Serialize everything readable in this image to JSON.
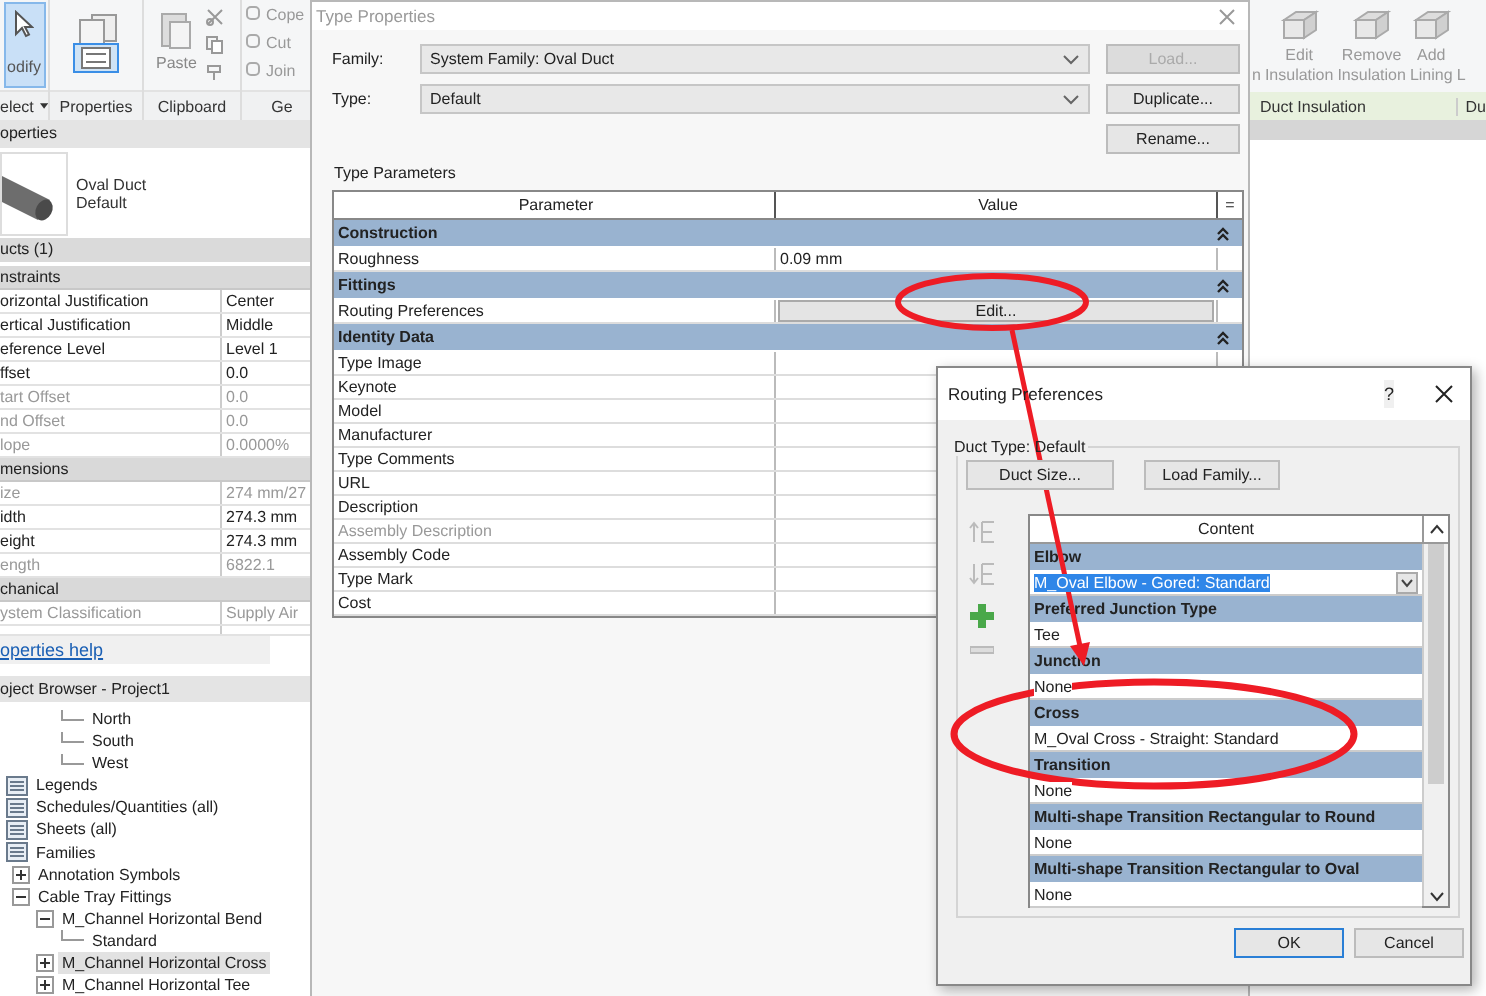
{
  "ribbon_left": {
    "modify": {
      "label": "odify",
      "selected": true
    },
    "panel_labels": [
      "elect",
      "Properties",
      "Clipboard",
      "Ge"
    ],
    "paste": "Paste",
    "geometry_tools": [
      "Cope",
      "Cut",
      "Join"
    ]
  },
  "ribbon_right": {
    "buttons": [
      {
        "lines": [
          "n"
        ]
      },
      {
        "lines": [
          "Edit",
          "Insulation"
        ]
      },
      {
        "lines": [
          "Remove",
          "Insulation"
        ]
      },
      {
        "lines": [
          "Add",
          "Lining"
        ]
      },
      {
        "lines": [
          "L"
        ]
      }
    ],
    "panel_labels": [
      "Duct Insulation",
      "Du"
    ]
  },
  "properties": {
    "title": "operties",
    "type_name": "Oval Duct",
    "type_sub": "Default",
    "instance": "ucts (1)",
    "groups": [
      {
        "name": "nstraints",
        "rows": [
          {
            "label": "orizontal Justification",
            "value": "Center",
            "disabled": false
          },
          {
            "label": "ertical Justification",
            "value": "Middle",
            "disabled": false
          },
          {
            "label": "eference Level",
            "value": "Level 1",
            "disabled": false
          },
          {
            "label": "ffset",
            "value": "0.0",
            "disabled": false
          },
          {
            "label": "tart Offset",
            "value": "0.0",
            "disabled": true
          },
          {
            "label": "nd Offset",
            "value": "0.0",
            "disabled": true
          },
          {
            "label": "lope",
            "value": "0.0000%",
            "disabled": true
          }
        ]
      },
      {
        "name": "mensions",
        "rows": [
          {
            "label": "ize",
            "value": "274 mm/27",
            "disabled": true
          },
          {
            "label": "idth",
            "value": "274.3 mm",
            "disabled": false
          },
          {
            "label": "eight",
            "value": "274.3 mm",
            "disabled": false
          },
          {
            "label": "ength",
            "value": "6822.1",
            "disabled": true
          }
        ]
      },
      {
        "name": "chanical",
        "rows": [
          {
            "label": "ystem Classification",
            "value": "Supply Air",
            "disabled": true
          }
        ]
      }
    ],
    "help_link": "operties help"
  },
  "project_browser": {
    "title": "oject Browser - Project1",
    "views": [
      "North",
      "South",
      "West"
    ],
    "tree": [
      {
        "label": "Legends",
        "selected": false
      },
      {
        "label": "Schedules/Quantities (all)",
        "selected": false
      },
      {
        "label": "Sheets (all)",
        "selected": false
      },
      {
        "label": "Families",
        "selected": false,
        "children": [
          {
            "label": "Annotation Symbols",
            "selected": false,
            "expanded": false
          },
          {
            "label": "Cable Tray Fittings",
            "selected": false,
            "expanded": true,
            "children": [
              {
                "label": "M_Channel Horizontal Bend",
                "selected": false,
                "expanded": true,
                "children": [
                  {
                    "label": "Standard",
                    "selected": false
                  }
                ]
              },
              {
                "label": "M_Channel Horizontal Cross",
                "selected": true,
                "expanded": false
              },
              {
                "label": "M_Channel Horizontal Tee",
                "selected": false,
                "expanded": false
              }
            ]
          }
        ]
      }
    ]
  },
  "type_properties": {
    "title": "Type Properties",
    "family_label": "Family:",
    "family_value": "System Family: Oval Duct",
    "type_label": "Type:",
    "type_value": "Default",
    "buttons": [
      {
        "label": "Load...",
        "disabled": true
      },
      {
        "label": "Duplicate...",
        "disabled": false
      },
      {
        "label": "Rename...",
        "disabled": false
      }
    ],
    "section_label": "Type Parameters",
    "columns": [
      "Parameter",
      "Value"
    ],
    "sort_button": "=",
    "groups": [
      {
        "name": "Construction",
        "rows": [
          {
            "parameter": "Roughness",
            "value": "0.09 mm",
            "kind": "text",
            "disabled": false
          }
        ]
      },
      {
        "name": "Fittings",
        "rows": [
          {
            "parameter": "Routing Preferences",
            "value": "Edit...",
            "kind": "button",
            "disabled": false
          }
        ]
      },
      {
        "name": "Identity Data",
        "rows": [
          {
            "parameter": "Type Image",
            "kind": "text",
            "disabled": false
          },
          {
            "parameter": "Keynote",
            "kind": "text",
            "disabled": false
          },
          {
            "parameter": "Model",
            "kind": "text",
            "disabled": false
          },
          {
            "parameter": "Manufacturer",
            "kind": "text",
            "disabled": false
          },
          {
            "parameter": "Type Comments",
            "kind": "text",
            "disabled": false
          },
          {
            "parameter": "URL",
            "kind": "text",
            "disabled": false
          },
          {
            "parameter": "Description",
            "kind": "text",
            "disabled": false
          },
          {
            "parameter": "Assembly Description",
            "kind": "text",
            "disabled": true
          },
          {
            "parameter": "Assembly Code",
            "kind": "text",
            "disabled": false
          },
          {
            "parameter": "Type Mark",
            "kind": "text",
            "disabled": false
          },
          {
            "parameter": "Cost",
            "kind": "text",
            "disabled": false
          }
        ]
      }
    ]
  },
  "routing_preferences": {
    "title": "Routing Preferences",
    "help": "?",
    "duct_type_label": "Duct Type: Default",
    "buttons": [
      "Duct Size...",
      "Load Family..."
    ],
    "column": "Content",
    "groups": [
      {
        "name": "Elbow",
        "value": "M_Oval Elbow - Gored: Standard",
        "selected": true
      },
      {
        "name": "Preferred Junction Type",
        "value": "Tee",
        "selected": false
      },
      {
        "name": "Junction",
        "value": "None",
        "selected": false
      },
      {
        "name": "Cross",
        "value": "M_Oval Cross - Straight: Standard",
        "selected": false
      },
      {
        "name": "Transition",
        "value": "None",
        "selected": false
      },
      {
        "name": "Multi-shape Transition Rectangular to Round",
        "value": "None",
        "selected": false
      },
      {
        "name": "Multi-shape Transition Rectangular to Oval",
        "value": "None",
        "selected": false
      }
    ],
    "footer_buttons": [
      {
        "label": "OK",
        "focused": true
      },
      {
        "label": "Cancel",
        "focused": false
      }
    ]
  }
}
